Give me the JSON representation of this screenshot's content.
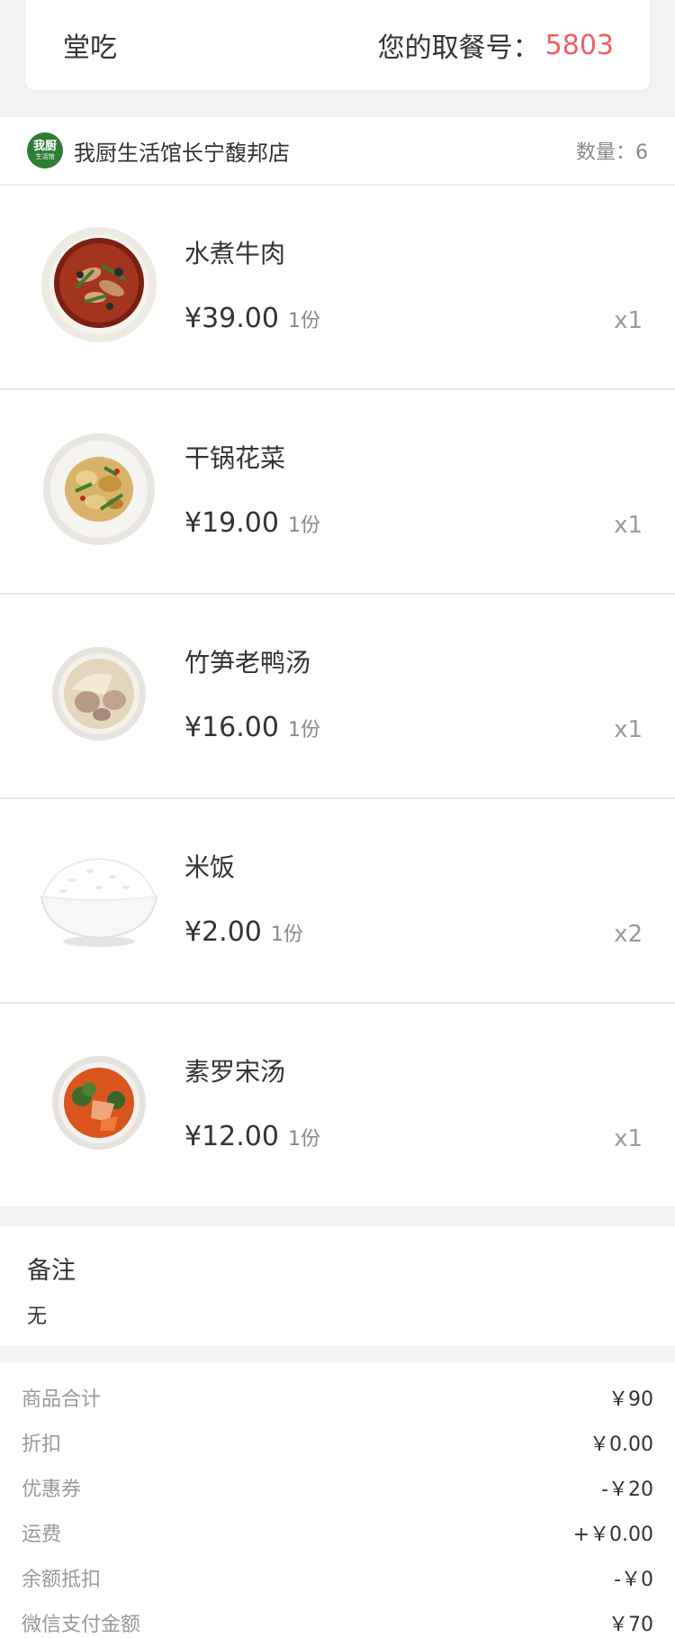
{
  "pickup": {
    "type": "堂吃",
    "label": "您的取餐号：",
    "number": "5803"
  },
  "store": {
    "logo_text_1": "我厨",
    "logo_text_2": "生活馆",
    "name": "我厨生活馆长宁馥邦店",
    "qty": "数量：6"
  },
  "items": [
    {
      "name": "水煮牛肉",
      "price": "¥39.00",
      "unit": "1份",
      "qty": "x1",
      "image": "boiled-beef-icon"
    },
    {
      "name": "干锅花菜",
      "price": "¥19.00",
      "unit": "1份",
      "qty": "x1",
      "image": "dry-pot-cauliflower-icon"
    },
    {
      "name": "竹笋老鸭汤",
      "price": "¥16.00",
      "unit": "1份",
      "qty": "x1",
      "image": "duck-soup-icon"
    },
    {
      "name": "米饭",
      "price": "¥2.00",
      "unit": "1份",
      "qty": "x2",
      "image": "rice-bowl-icon"
    },
    {
      "name": "素罗宋汤",
      "price": "¥12.00",
      "unit": "1份",
      "qty": "x1",
      "image": "borscht-icon"
    }
  ],
  "note": {
    "title": "备注",
    "value": "无"
  },
  "summary": [
    {
      "label": "商品合计",
      "value": "￥90"
    },
    {
      "label": "折扣",
      "value": "￥0.00"
    },
    {
      "label": "优惠券",
      "value": "-￥20"
    },
    {
      "label": "运费",
      "value": "+￥0.00"
    },
    {
      "label": "余额抵扣",
      "value": "-￥0"
    },
    {
      "label": "微信支付金额",
      "value": "￥70"
    }
  ],
  "colors": {
    "accent": "#f0605d",
    "logo_green": "#2f7d32"
  }
}
